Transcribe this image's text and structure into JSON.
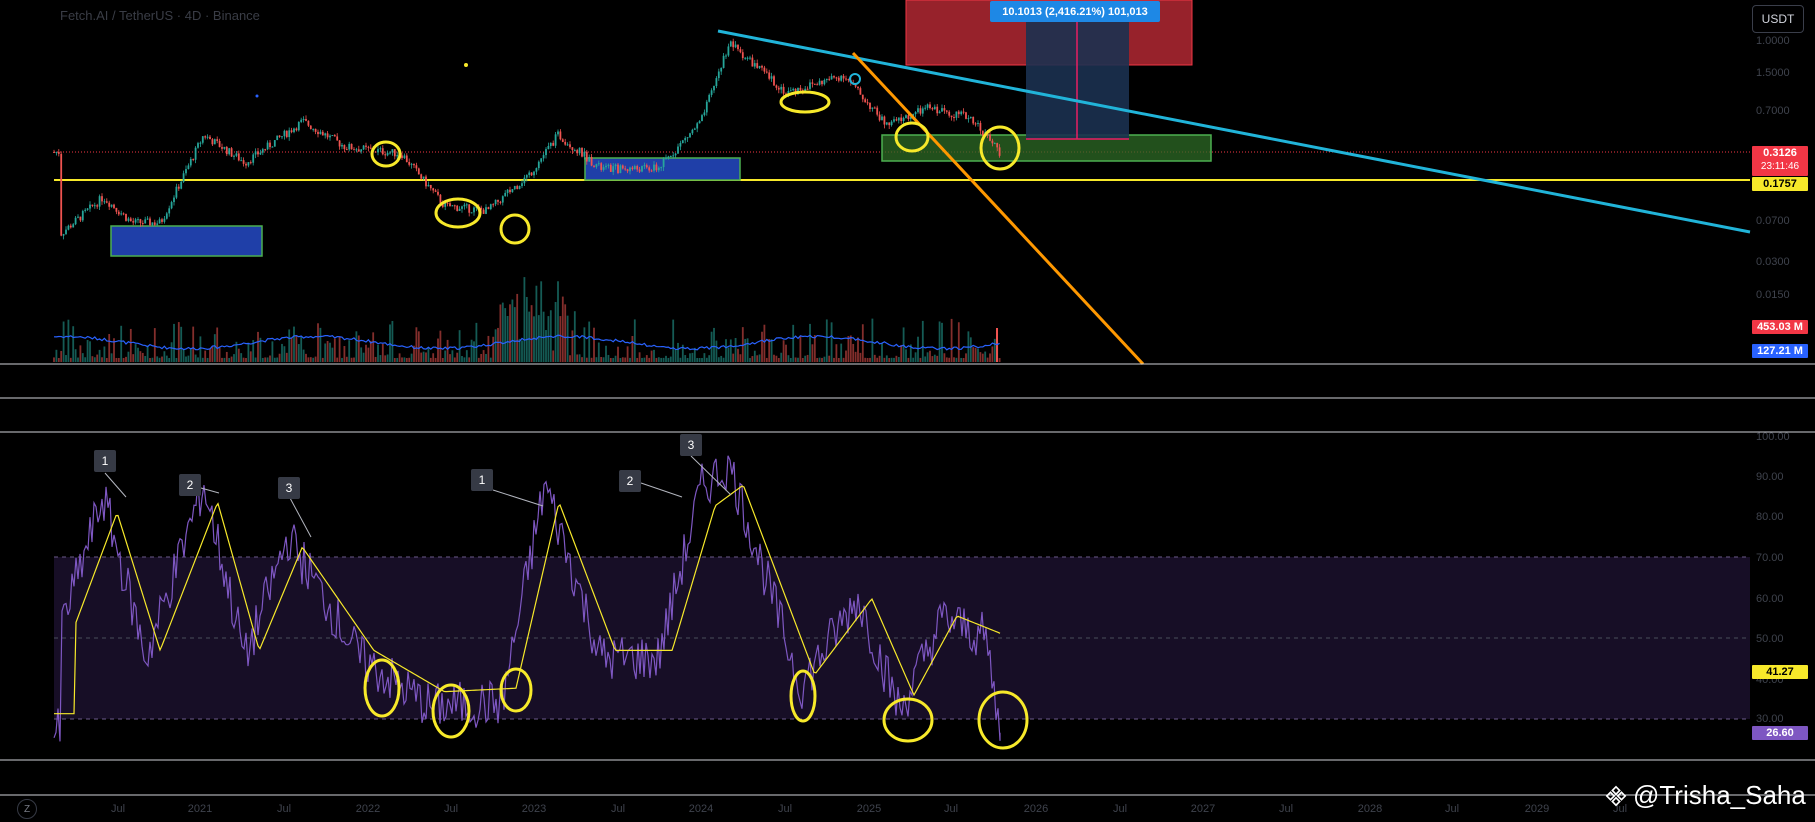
{
  "header": {
    "symbol_title": "Fetch.AI / TetherUS · 4D · Binance",
    "currency": "USDT"
  },
  "price_axis": {
    "ticks": [
      "1.0000",
      "1.5000",
      "0.7000",
      "0.0700",
      "0.0300",
      "0.0150"
    ]
  },
  "rsi_axis": {
    "ticks": [
      "100.00",
      "90.00",
      "80.00",
      "70.00",
      "60.00",
      "50.00",
      "40.00",
      "30.00"
    ]
  },
  "time_axis": {
    "ticks": [
      "Jul",
      "2021",
      "Jul",
      "2022",
      "Jul",
      "2023",
      "Jul",
      "2024",
      "Jul",
      "2025",
      "Jul",
      "2026",
      "Jul",
      "2027",
      "Jul",
      "2028",
      "Jul",
      "2029",
      "Jul"
    ]
  },
  "tags": {
    "price": "0.3126",
    "countdown": "23:11:46",
    "support": "0.1757",
    "volume": "453.03 M",
    "volume_ma": "127.21 M",
    "rsi_ma": "41.27",
    "rsi": "26.60",
    "measure": "10.1013 (2,416.21%) 101,013"
  },
  "badges": [
    "1",
    "2",
    "3",
    "1",
    "2",
    "3"
  ],
  "watermark": "@Trisha_Saha",
  "tv_logo": "Z",
  "colors": {
    "bg": "#000000",
    "up": "#26a69a",
    "down": "#ef5350",
    "support": "#f7e92a",
    "trend_blue": "#21b4d9",
    "trend_orange": "#ff9800",
    "rsi": "#7e57c2",
    "rsi_ma": "#f7e92a"
  },
  "chart_data": {
    "type": "candlestick+rsi",
    "price_scale": "log",
    "support_level": 0.1757,
    "current_price": 0.3126,
    "rsi_bands": [
      30,
      50,
      70
    ],
    "rsi_current": 26.6,
    "rsi_ma_current": 41.27,
    "price_path": [
      {
        "date": "2020-04",
        "v": 0.055
      },
      {
        "date": "2020-07",
        "v": 0.12
      },
      {
        "date": "2020-09",
        "v": 0.07
      },
      {
        "date": "2020-11",
        "v": 0.07
      },
      {
        "date": "2021-02",
        "v": 0.45
      },
      {
        "date": "2021-05",
        "v": 0.25
      },
      {
        "date": "2021-09",
        "v": 0.6
      },
      {
        "date": "2021-12",
        "v": 0.35
      },
      {
        "date": "2022-04",
        "v": 0.3
      },
      {
        "date": "2022-07",
        "v": 0.1
      },
      {
        "date": "2022-10",
        "v": 0.09
      },
      {
        "date": "2023-01",
        "v": 0.2
      },
      {
        "date": "2023-03",
        "v": 0.45
      },
      {
        "date": "2023-06",
        "v": 0.22
      },
      {
        "date": "2023-10",
        "v": 0.22
      },
      {
        "date": "2024-01",
        "v": 0.6
      },
      {
        "date": "2024-03",
        "v": 3.2
      },
      {
        "date": "2024-07",
        "v": 1.1
      },
      {
        "date": "2024-11",
        "v": 1.6
      },
      {
        "date": "2025-02",
        "v": 0.55
      },
      {
        "date": "2025-05",
        "v": 0.8
      },
      {
        "date": "2025-08",
        "v": 0.65
      },
      {
        "date": "2025-10",
        "v": 0.3126
      }
    ],
    "rsi_path": [
      {
        "date": "2020-04",
        "v": 52
      },
      {
        "date": "2020-07",
        "v": 85
      },
      {
        "date": "2020-10",
        "v": 45
      },
      {
        "date": "2021-02",
        "v": 88
      },
      {
        "date": "2021-05",
        "v": 45
      },
      {
        "date": "2021-08",
        "v": 75
      },
      {
        "date": "2022-01",
        "v": 45
      },
      {
        "date": "2022-06",
        "v": 33
      },
      {
        "date": "2022-11",
        "v": 34
      },
      {
        "date": "2023-02",
        "v": 88
      },
      {
        "date": "2023-06",
        "v": 45
      },
      {
        "date": "2023-10",
        "v": 45
      },
      {
        "date": "2024-01",
        "v": 87
      },
      {
        "date": "2024-03",
        "v": 93
      },
      {
        "date": "2024-08",
        "v": 38
      },
      {
        "date": "2024-12",
        "v": 60
      },
      {
        "date": "2025-03",
        "v": 32
      },
      {
        "date": "2025-06",
        "v": 55
      },
      {
        "date": "2025-09",
        "v": 50
      },
      {
        "date": "2025-10",
        "v": 26.6
      }
    ]
  }
}
